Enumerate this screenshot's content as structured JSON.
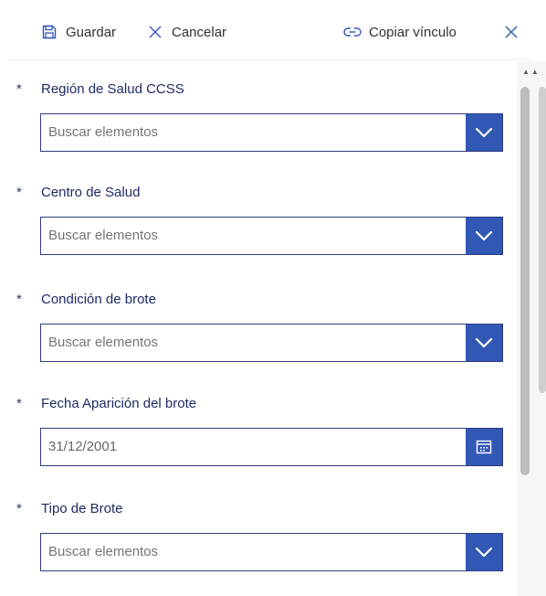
{
  "toolbar": {
    "save_label": "Guardar",
    "cancel_label": "Cancelar",
    "copy_link_label": "Copiar vínculo"
  },
  "required_marker": "*",
  "fields": [
    {
      "label": "Región de Salud CCSS",
      "placeholder": "Buscar elementos",
      "type": "dropdown"
    },
    {
      "label": "Centro de Salud",
      "placeholder": "Buscar elementos",
      "type": "dropdown"
    },
    {
      "label": "Condición de brote",
      "placeholder": "Buscar elementos",
      "type": "dropdown"
    },
    {
      "label": "Fecha Aparición del brote",
      "value": "31/12/2001",
      "type": "date"
    },
    {
      "label": "Tipo de Brote",
      "placeholder": "Buscar elementos",
      "type": "dropdown"
    }
  ],
  "colors": {
    "accent": "#3258b6",
    "label": "#1e2b63",
    "border": "#2e3d80",
    "placeholder": "#757575"
  },
  "icons": {
    "save": "save-icon",
    "cancel": "close-icon",
    "copy_link": "link-icon",
    "close": "close-icon",
    "dropdown": "chevron-down-icon",
    "calendar": "calendar-icon"
  }
}
